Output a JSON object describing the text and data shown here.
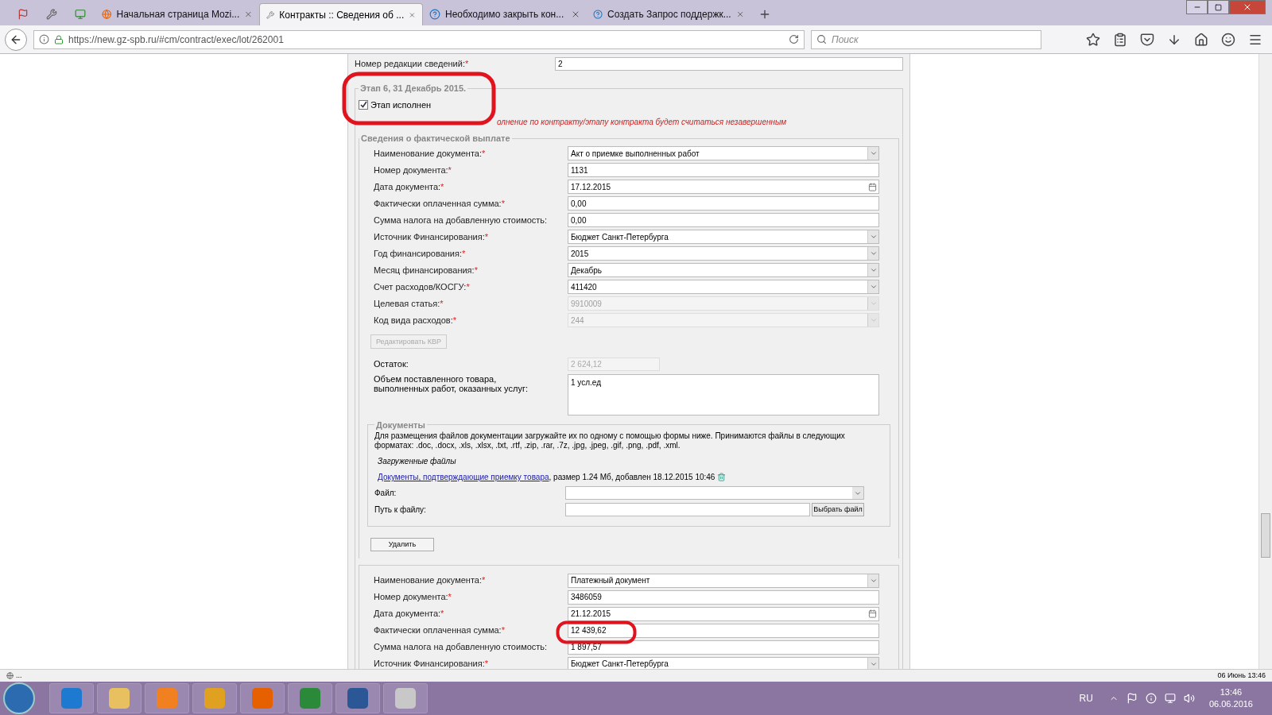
{
  "browser": {
    "tabs": [
      {
        "title": "Начальная страница Mozi...",
        "selected": false
      },
      {
        "title": "Контракты :: Сведения об ...",
        "selected": true
      },
      {
        "title": "Необходимо закрыть кон...",
        "selected": false
      },
      {
        "title": "Создать Запрос поддержк...",
        "selected": false
      }
    ],
    "url": "https://new.gz-spb.ru/#cm/contract/exec/lot/262001",
    "search_placeholder": "Поиск"
  },
  "form": {
    "top_field": {
      "label": "Номер редакции сведений:",
      "required_mark": "*",
      "value": "2"
    },
    "stage": {
      "title": "Этап 6, 31 Декабрь 2015.",
      "done_label": "Этап исполнен",
      "done_checked": true,
      "warning": "олнение по контракту/этапу контракта будет считаться незавершенным",
      "payment_title": "Сведения о фактической выплате",
      "fields": [
        {
          "kind": "select",
          "label": "Наименование документа:",
          "required_mark": "*",
          "value": "Акт о приемке выполненных работ",
          "disabled": false
        },
        {
          "kind": "text",
          "label": "Номер документа:",
          "required_mark": "*",
          "value": "1131",
          "disabled": false
        },
        {
          "kind": "date",
          "label": "Дата документа:",
          "required_mark": "*",
          "value": "17.12.2015",
          "disabled": false
        },
        {
          "kind": "text",
          "label": "Фактически оплаченная сумма:",
          "required_mark": "*",
          "value": "0,00",
          "disabled": false
        },
        {
          "kind": "text",
          "label": "Сумма налога на добавленную стоимость:",
          "value": "0,00",
          "disabled": false
        },
        {
          "kind": "select",
          "label": "Источник Финансирования:",
          "required_mark": "*",
          "value": "Бюджет Санкт-Петербурга",
          "disabled": false
        },
        {
          "kind": "select",
          "label": "Год финансирования:",
          "required_mark": "*",
          "value": "2015",
          "disabled": false
        },
        {
          "kind": "select",
          "label": "Месяц финансирования:",
          "required_mark": "*",
          "value": "Декабрь",
          "disabled": false
        },
        {
          "kind": "select",
          "label": "Счет расходов/КОСГУ:",
          "required_mark": "*",
          "value": "411420",
          "disabled": false
        },
        {
          "kind": "select",
          "label": "Целевая статья:",
          "required_mark": "*",
          "value": "9910009",
          "disabled": true
        },
        {
          "kind": "select",
          "label": "Код вида расходов:",
          "required_mark": "*",
          "value": "244",
          "disabled": true
        }
      ],
      "kvr_button": {
        "label": "Редактировать КВР",
        "disabled": true
      },
      "remainder": {
        "label": "Остаток:",
        "value": "2 624,12"
      },
      "volume": {
        "label": "Объем поставленного товара, выполненных работ, оказанных услуг:",
        "value": "1 усл.ед"
      },
      "documents": {
        "title": "Документы",
        "description": "Для размещения файлов документации загружайте их по одному с помощью формы ниже. Принимаются файлы в следующих форматах: .doc, .docx, .xls, .xlsx, .txt, .rtf, .zip, .rar, .7z, .jpg, .jpeg, .gif, .png, .pdf, .xml.",
        "uploaded_title": "Загруженные файлы",
        "file_link": "Документы, подтверждающие приемку товара",
        "file_info": ", размер 1.24 Мб, добавлен 18.12.2015 10:46",
        "file_label": "Файл:",
        "path_label": "Путь к файлу:",
        "choose_button": "Выбрать файл"
      },
      "delete_button": "Удалить",
      "fields_2": [
        {
          "kind": "select",
          "label": "Наименование документа:",
          "required_mark": "*",
          "value": "Платежный документ",
          "disabled": false
        },
        {
          "kind": "text",
          "label": "Номер документа:",
          "required_mark": "*",
          "value": "3486059",
          "disabled": false
        },
        {
          "kind": "date",
          "label": "Дата документа:",
          "required_mark": "*",
          "value": "21.12.2015",
          "disabled": false
        },
        {
          "kind": "text",
          "label": "Фактически оплаченная сумма:",
          "required_mark": "*",
          "value": "12 439,62",
          "disabled": false
        },
        {
          "kind": "text",
          "label": "Сумма налога на добавленную стоимость:",
          "value": "1 897,57",
          "disabled": false
        },
        {
          "kind": "select",
          "label": "Источник Финансирования:",
          "required_mark": "*",
          "value": "Бюджет Санкт-Петербурга",
          "disabled": false
        }
      ]
    }
  },
  "status_bar": {
    "left": "...",
    "right": "06 Июнь 13:46"
  },
  "taskbar": {
    "language": "RU",
    "time": "13:46",
    "date": "06.06.2016"
  }
}
